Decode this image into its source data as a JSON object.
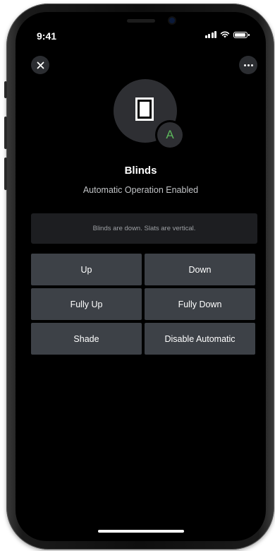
{
  "status_bar": {
    "time": "9:41"
  },
  "header": {
    "close_icon": "close-icon",
    "more_icon": "more-dots-icon"
  },
  "accessory": {
    "icon": "blinds-icon",
    "badge_letter": "A",
    "badge_color": "#5cb85c",
    "name": "Blinds",
    "mode": "Automatic Operation Enabled",
    "state": "Blinds are down. Slats are vertical."
  },
  "actions": [
    {
      "label": "Up"
    },
    {
      "label": "Down"
    },
    {
      "label": "Fully Up"
    },
    {
      "label": "Fully Down"
    },
    {
      "label": "Shade"
    },
    {
      "label": "Disable Automatic"
    }
  ],
  "colors": {
    "background": "#000000",
    "button": "#3d4147",
    "status_panel": "#1d1e21"
  }
}
